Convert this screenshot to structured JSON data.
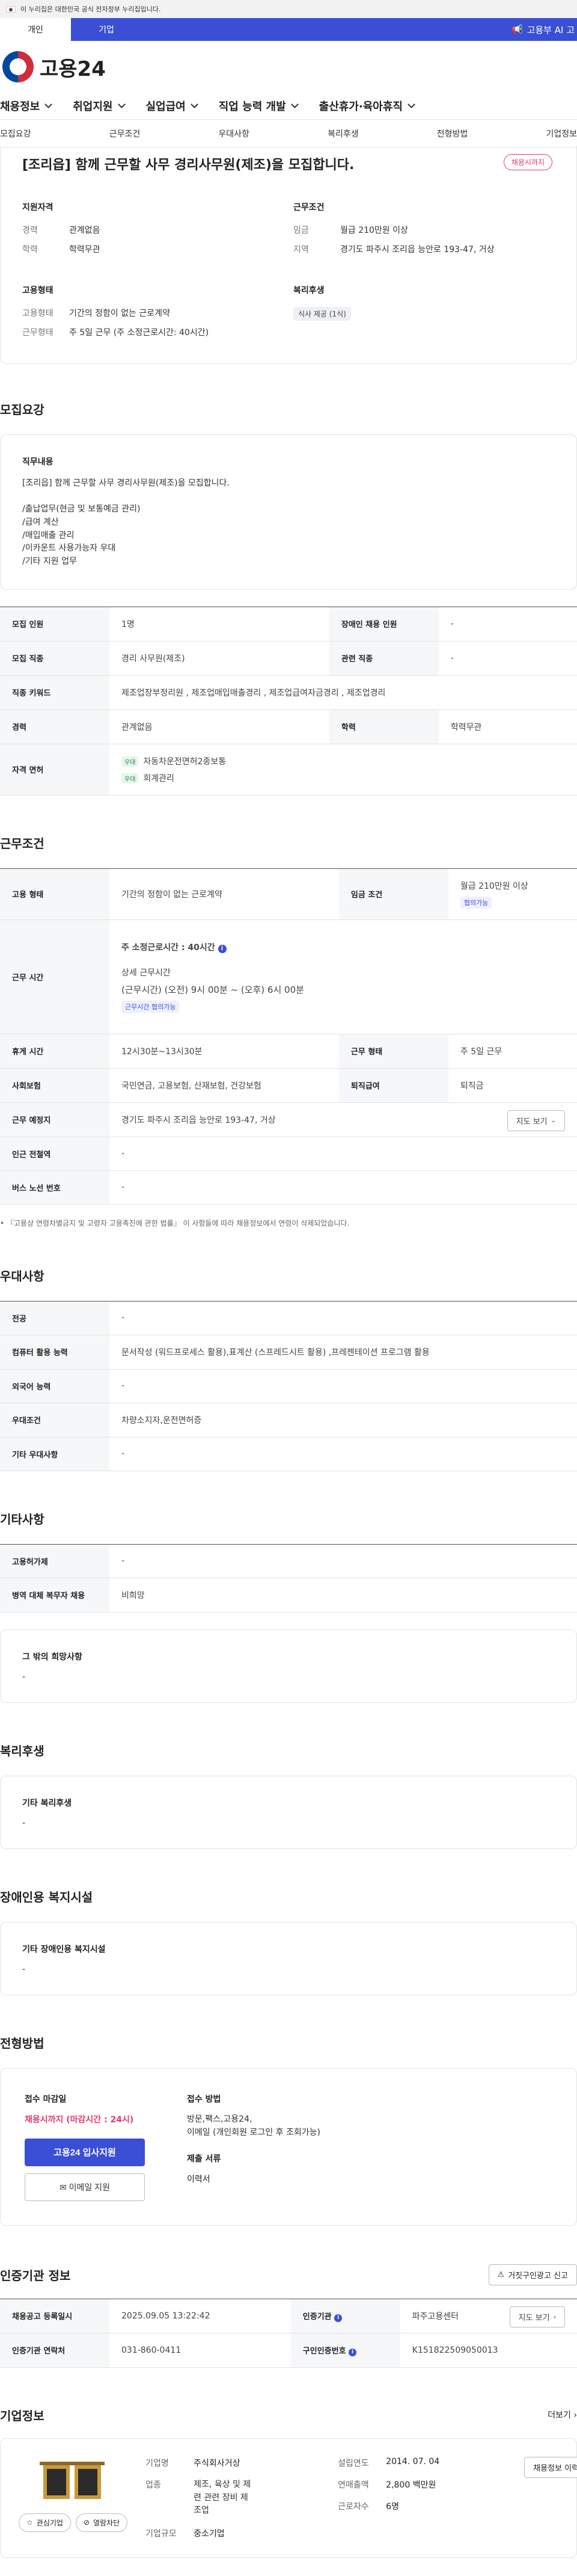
{
  "gov_banner": "이 누리집은 대한민국 공식 전자정부 누리집입니다.",
  "user_tabs": [
    "개인",
    "기업"
  ],
  "ai_link": "고용부 AI 고",
  "logo_text": "고용24",
  "gnb": [
    "채용정보",
    "취업지원",
    "실업급여",
    "직업 능력 개발",
    "출산휴가·육아휴직"
  ],
  "subnav": [
    "모집요강",
    "근무조건",
    "우대사항",
    "복리후생",
    "전형방법",
    "기업정보"
  ],
  "job": {
    "title": "[조리읍] 함께 근무할 사무 경리사무원(제조)을 모집합니다.",
    "status": "채용시까지",
    "qualification_title": "지원자격",
    "career_label": "경력",
    "career": "관계없음",
    "education_label": "학력",
    "education": "학력무관",
    "condition_title": "근무조건",
    "wage_label": "임금",
    "wage": "월급 210만원 이상",
    "region_label": "지역",
    "region": "경기도 파주시 조리읍 능안로 193-47, 거상",
    "employment_title": "고용형태",
    "emp_type_label": "고용형태",
    "emp_type": "기간의 정함이 없는 근로계약",
    "work_type_label": "근무형태",
    "work_type": "주 5일 근무 (주 소정근로시간: 40시간)",
    "welfare_title": "복리후생",
    "welfare_tag": "식사 제공 (1식)"
  },
  "recruit": {
    "section_title": "모집요강",
    "duty_title": "직무내용",
    "duty_text": "[조리읍] 함께 근무할 사무 경리사무원(제조)을 모집합니다.\n\n/출납업무(현금 및 보통예금 관리)\n/급여 계산\n/매입매출 관리\n/이카운트 사용가능자 우대\n/기타 지원 업무",
    "rows": {
      "headcount_label": "모집 인원",
      "headcount": "1명",
      "disabled_label": "장애인 채용 인원",
      "disabled": "-",
      "job_label": "모집 직종",
      "job": "경리 사무원(제조)",
      "related_label": "관련 직종",
      "related": "-",
      "keyword_label": "직종 키워드",
      "keyword": "제조업장부정리원 , 제조업매입매출경리 , 제조업급여자금경리 , 제조업경리",
      "career_label": "경력",
      "career": "관계없음",
      "edu_label": "학력",
      "edu": "학력무관",
      "license_label": "자격 면허",
      "license_tag": "우대",
      "license1": "자동차운전면허2종보통",
      "license2": "회계관리"
    }
  },
  "work": {
    "section_title": "근무조건",
    "emp_label": "고용 형태",
    "emp": "기간의 정함이 없는 근로계약",
    "wage_label": "임금 조건",
    "wage": "월급 210만원 이상",
    "wage_tag": "협의가능",
    "time_label": "근무 시간",
    "weekly_hours": "주 소정근로시간 : 40시간",
    "detail_title": "상세 근무시간",
    "detail_text": "(근무시간) (오전) 9시 00분 ~ (오후) 6시 00분",
    "time_tag": "근무시간 협의가능",
    "break_label": "휴게 시간",
    "break": "12시30분~13시30분",
    "shift_label": "근무 형태",
    "shift": "주 5일 근무",
    "insurance_label": "사회보험",
    "insurance": "국민연금, 고용보험, 산재보험, 건강보험",
    "retire_label": "퇴직급여",
    "retire": "퇴직금",
    "place_label": "근무 예정지",
    "place": "경기도 파주시 조리읍 능안로 193-47, 거상",
    "map_btn": "지도 보기",
    "subway_label": "인근 전철역",
    "subway": "-",
    "bus_label": "버스 노선 번호",
    "bus": "-",
    "note": "• 『고용상 연령차별금지 및 고령자 고용촉진에 관한 법률』 이 사항들에 따라 채용정보에서 연령이 삭제되었습니다."
  },
  "prefer": {
    "section_title": "우대사항",
    "major_label": "전공",
    "major": "-",
    "computer_label": "컴퓨터 활용 능력",
    "computer": "문서작성 (워드프로세스 활용),표계산 (스프레드시트 활용) ,프레젠테이션 프로그램 활용",
    "lang_label": "외국어 능력",
    "lang": "-",
    "cond_label": "우대조건",
    "cond": "차량소지자,운전면허증",
    "etc_label": "기타 우대사항",
    "etc": "-"
  },
  "other": {
    "section_title": "기타사항",
    "closed_label": "고용허가제",
    "closed": "-",
    "military_label": "병역 대체 복무자 채용",
    "military": "비희망",
    "hope_title": "그 밖의 희망사항",
    "hope": "-"
  },
  "welfare": {
    "section_title": "복리후생",
    "title": "기타 복리후생",
    "value": "-"
  },
  "disabled": {
    "section_title": "장애인용 복지시설",
    "title": "기타 장애인용 복지시설",
    "value": "-"
  },
  "apply": {
    "section_title": "전형방법",
    "deadline_title": "접수 마감일",
    "deadline": "채용시까지 (마감시간 : 24시)",
    "apply_btn": "고용24 입사지원",
    "email_btn": "이메일 지원",
    "method_title": "접수 방법",
    "method": "방문,팩스,고용24,\n이메일 (개인회원 로그인 후 조회가능)",
    "docs_title": "제출 서류",
    "docs": "이력서"
  },
  "agency": {
    "section_title": "인증기관 정보",
    "report_btn": "거짓구인광고 신고",
    "reg_date_label": "채용공고 등록일시",
    "reg_date": "2025.09.05 13:22:42",
    "agency_label": "인증기관",
    "agency": "파주고용센터",
    "map_btn": "지도 보기",
    "phone_label": "인증기관 연락처",
    "phone": "031-860-0411",
    "cert_label": "구인인증번호",
    "cert": "K151822509050013"
  },
  "company": {
    "section_title": "기업정보",
    "more": "더보기",
    "fav_btn": "관심기업",
    "ban_btn": "열람차단",
    "type_label": "기업명",
    "type": "주식회사거상",
    "founded_label": "설립연도",
    "founded": "2014. 07. 04",
    "industry_label": "업종",
    "industry": "제조, 육상 및 제\n련 관련 장비 제\n조업",
    "sales_label": "연매출액",
    "sales": "2,800 백만원",
    "emp_label": "근로자수",
    "emp": "6명",
    "size_label": "기업규모",
    "size": "중소기업",
    "hire_btn": "채용정보 이력"
  }
}
